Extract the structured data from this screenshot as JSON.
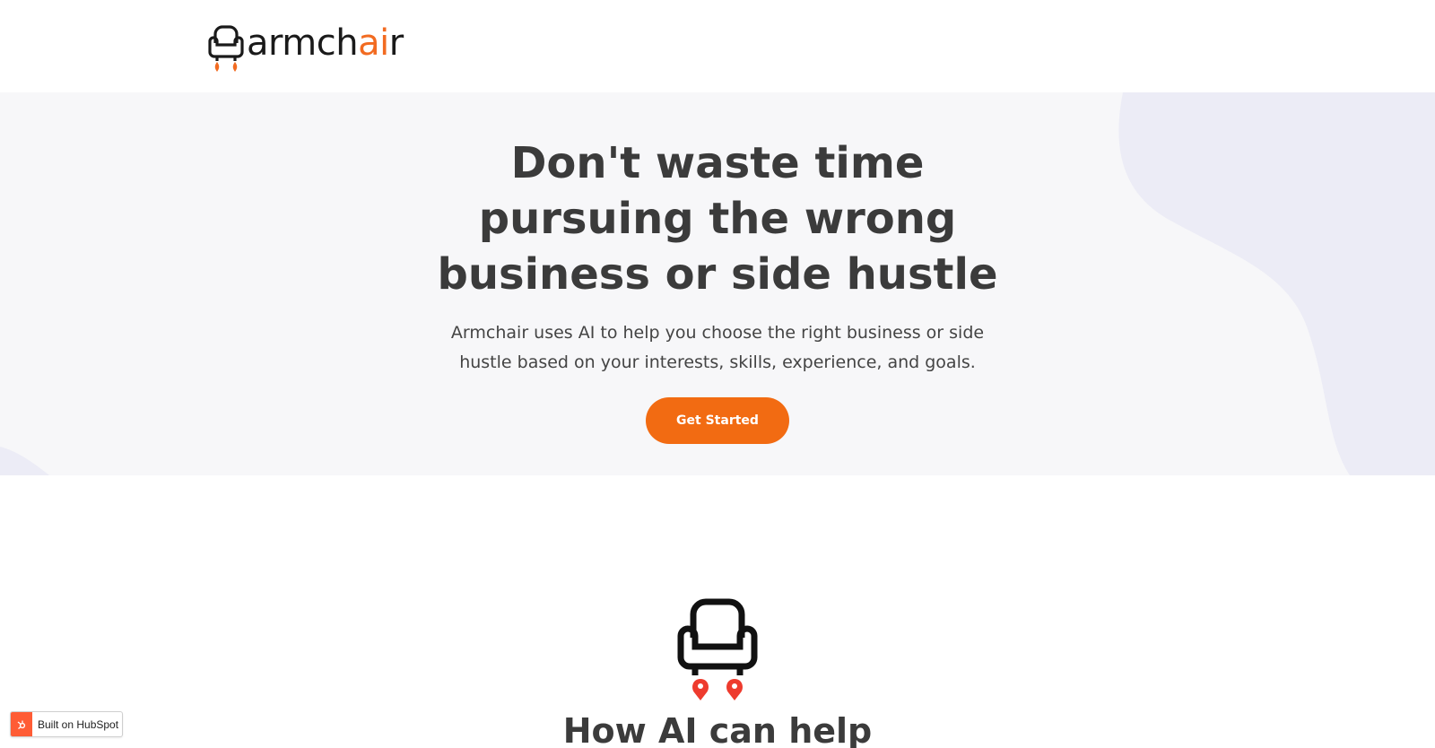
{
  "brand": {
    "logo_text_main": "armch",
    "logo_text_accent": "ai",
    "logo_text_tail": "r"
  },
  "colors": {
    "accent": "#f26b12",
    "hero_bg": "#f7f7f9",
    "blob": "#ececf6",
    "heading": "#3b3b3b"
  },
  "hero": {
    "title": "Don't waste time pursuing the wrong business or side hustle",
    "subtitle": "Armchair uses AI to help you choose the right business or side hustle based on your interests, skills, experience, and goals.",
    "cta_label": "Get Started"
  },
  "section": {
    "title": "How AI can help"
  },
  "badge": {
    "label": "Built on HubSpot"
  }
}
